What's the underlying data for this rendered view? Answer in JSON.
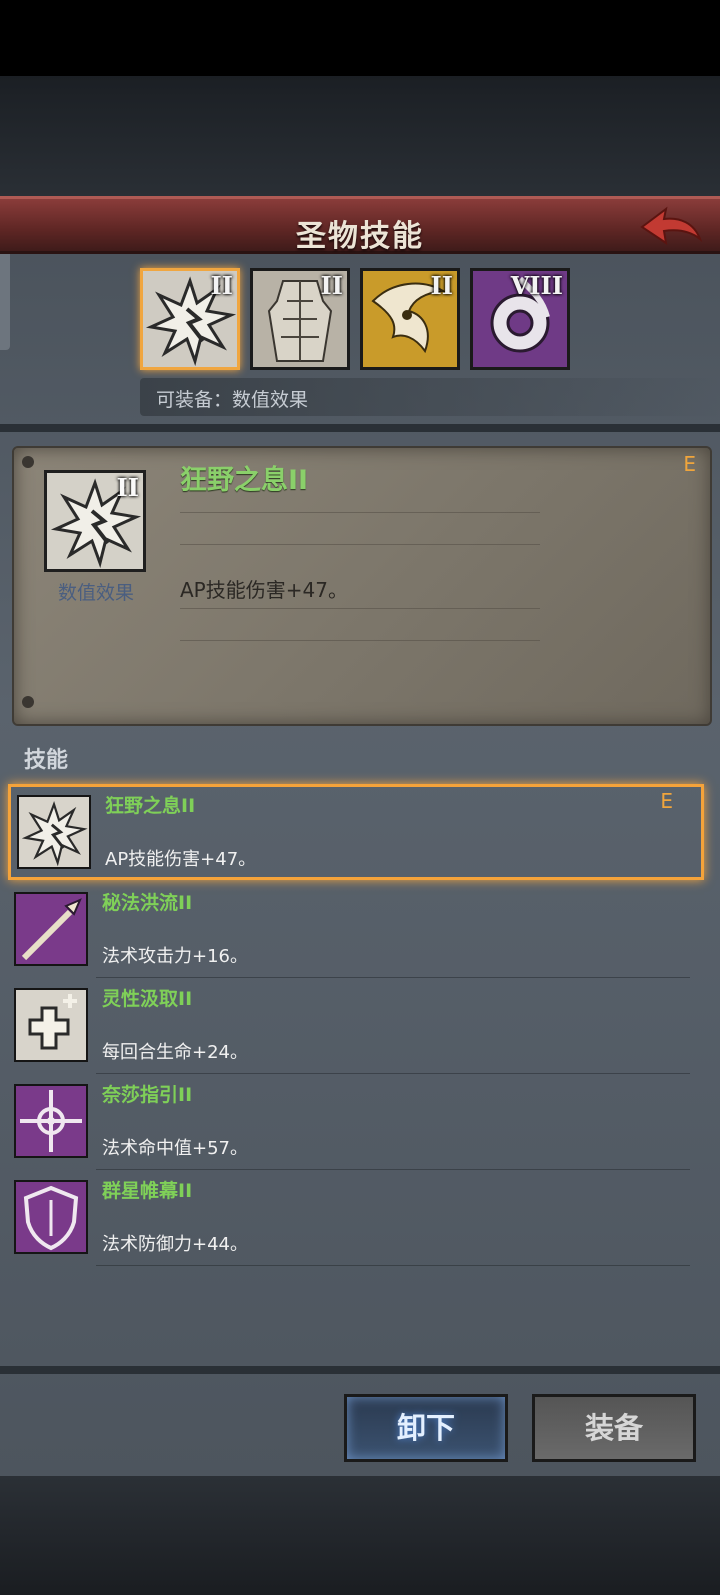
{
  "header": {
    "title": "圣物技能"
  },
  "relics": [
    {
      "level": "II",
      "icon": "explosion-icon",
      "selected": true
    },
    {
      "level": "II",
      "icon": "armored-figure-icon",
      "selected": false
    },
    {
      "level": "II",
      "icon": "bird-skull-icon",
      "selected": false
    },
    {
      "level": "VIII",
      "icon": "arcane-sigil-icon",
      "selected": false
    }
  ],
  "equip_hint": "可装备：数值效果",
  "detail": {
    "level": "II",
    "type": "数值效果",
    "name": "狂野之息II",
    "tag": "E",
    "desc": "AP技能伤害+47。"
  },
  "section_label": "技能",
  "skills": [
    {
      "name": "狂野之息II",
      "desc": "AP技能伤害+47。",
      "tag": "E",
      "icon": "explosion-icon",
      "color": "#d8d4cb"
    },
    {
      "name": "秘法洪流II",
      "desc": "法术攻击力+16。",
      "tag": "",
      "icon": "spear-icon",
      "color": "#7a3a8a"
    },
    {
      "name": "灵性汲取II",
      "desc": "每回合生命+24。",
      "tag": "",
      "icon": "health-cross-icon",
      "color": "#d8d4cb"
    },
    {
      "name": "奈莎指引II",
      "desc": "法术命中值+57。",
      "tag": "",
      "icon": "compass-star-icon",
      "color": "#7a3a8a"
    },
    {
      "name": "群星帷幕II",
      "desc": "法术防御力+44。",
      "tag": "",
      "icon": "shield-icon",
      "color": "#7a3a8a"
    }
  ],
  "buttons": {
    "unequip": "卸下",
    "equip": "装备"
  }
}
